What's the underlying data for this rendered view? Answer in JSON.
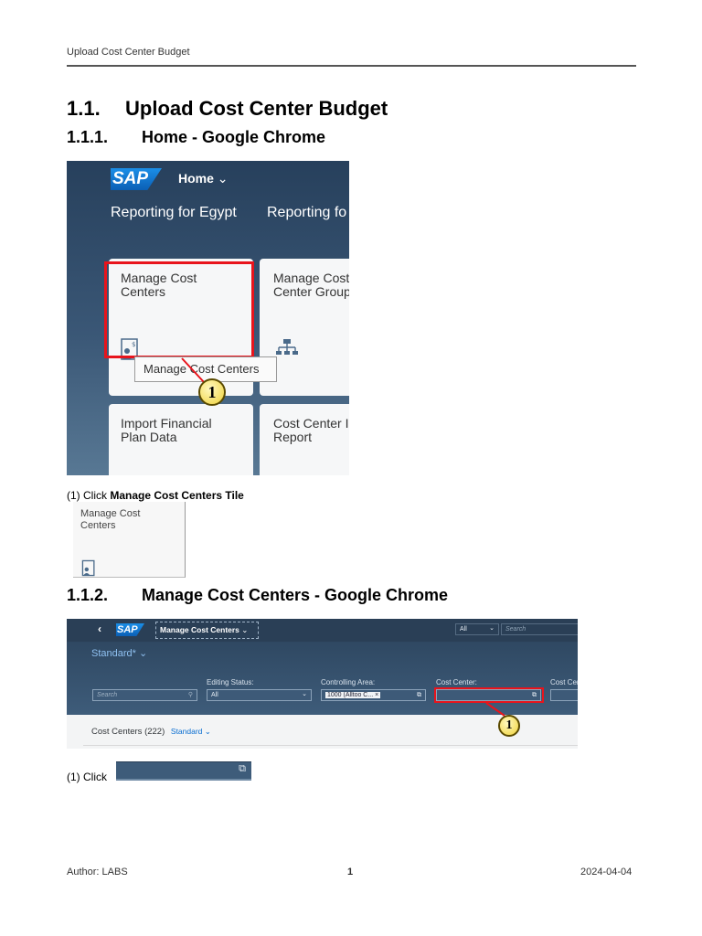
{
  "header": {
    "title": "Upload Cost Center Budget"
  },
  "section": {
    "number": "1.1.",
    "title": "Upload Cost Center Budget"
  },
  "sub1": {
    "number": "1.1.1.",
    "title": "Home - Google Chrome"
  },
  "shot1": {
    "logo": "SAP",
    "home": "Home",
    "group1": "Reporting for Egypt",
    "group2": "Reporting fo",
    "tile1": "Manage Cost\nCenters",
    "tile2": "Manage Cost\nCenter Group",
    "tile3": "Import Financial\nPlan Data",
    "tile4": "Cost Center I\nReport",
    "tooltip": "Manage Cost Centers",
    "callout": "1"
  },
  "step1": {
    "prefix": "(1) Click ",
    "bold": "Manage Cost Centers Tile"
  },
  "mini_tile": {
    "label": "Manage Cost\nCenters"
  },
  "sub2": {
    "number": "1.1.2.",
    "title": "Manage Cost Centers - Google Chrome"
  },
  "shot2": {
    "logo": "SAP",
    "app_title": "Manage Cost Centers",
    "search_scope": "All",
    "search_placeholder": "Search",
    "variant": "Standard*",
    "filter_search_placeholder": "Search",
    "editing_status_label": "Editing Status:",
    "editing_status_value": "All",
    "controlling_area_label": "Controlling Area:",
    "controlling_area_value": "1000 (Alltoo C...",
    "cost_center_label": "Cost Center:",
    "cost_center_cut_label": "Cost Cen",
    "table_title": "Cost Centers (222)",
    "table_variant": "Standard",
    "callout": "1"
  },
  "step2": {
    "prefix": "(1) Click"
  },
  "footer": {
    "author": "Author: LABS",
    "page": "1",
    "date": "2024-04-04"
  },
  "colors": {
    "sap_blue": "#0b6fcf",
    "highlight_red": "#e8141c",
    "shell_dark": "#2a3f56"
  }
}
